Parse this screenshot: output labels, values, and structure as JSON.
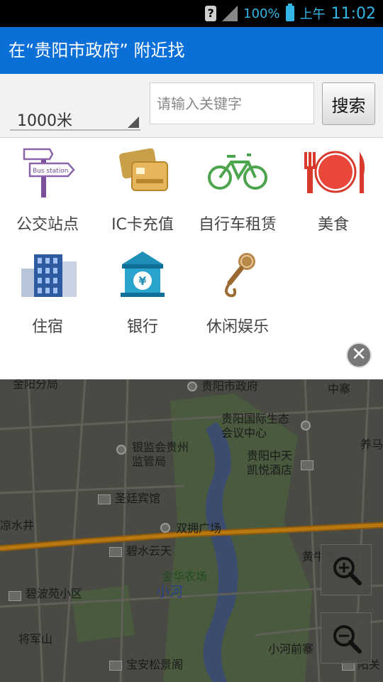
{
  "status_bar": {
    "signal_pct": "100%",
    "ampm": "上午",
    "time": "11:02"
  },
  "title_bar": {
    "title": "在“贵阳市政府” 附近找"
  },
  "search": {
    "distance": "1000米",
    "placeholder": "请输入关键字",
    "button": "搜索"
  },
  "categories": [
    {
      "label": "公交站点",
      "icon": "bus-stop-sign-icon",
      "sign_text": "Bus station"
    },
    {
      "label": "IC卡充值",
      "icon": "ic-card-icon"
    },
    {
      "label": "自行车租赁",
      "icon": "bicycle-icon"
    },
    {
      "label": "美食",
      "icon": "food-plate-icon"
    },
    {
      "label": "住宿",
      "icon": "hotel-building-icon"
    },
    {
      "label": "银行",
      "icon": "bank-icon",
      "symbol": "¥"
    },
    {
      "label": "休闲娱乐",
      "icon": "microphone-icon"
    }
  ],
  "close_label": "✕",
  "map": {
    "labels": [
      "金阳分局",
      "贵阳市政府",
      "中寨",
      "贵阳国际生态\n会议中心",
      "银监会贵州\n监管局",
      "贵阳中天\n凯悦酒店",
      "养马",
      "圣廷宾馆",
      "凉水井",
      "双拥广场",
      "碧水云天",
      "黄牛房",
      "金华农场",
      "小河",
      "碧波苑小区",
      "将军山",
      "小河前寨",
      "宝安松景阁",
      "阳关"
    ],
    "zoom_in": "zoom-in-icon",
    "zoom_out": "zoom-out-icon"
  },
  "colors": {
    "title_bg": "#0b6fd8",
    "status_accent": "#33b5e5"
  }
}
